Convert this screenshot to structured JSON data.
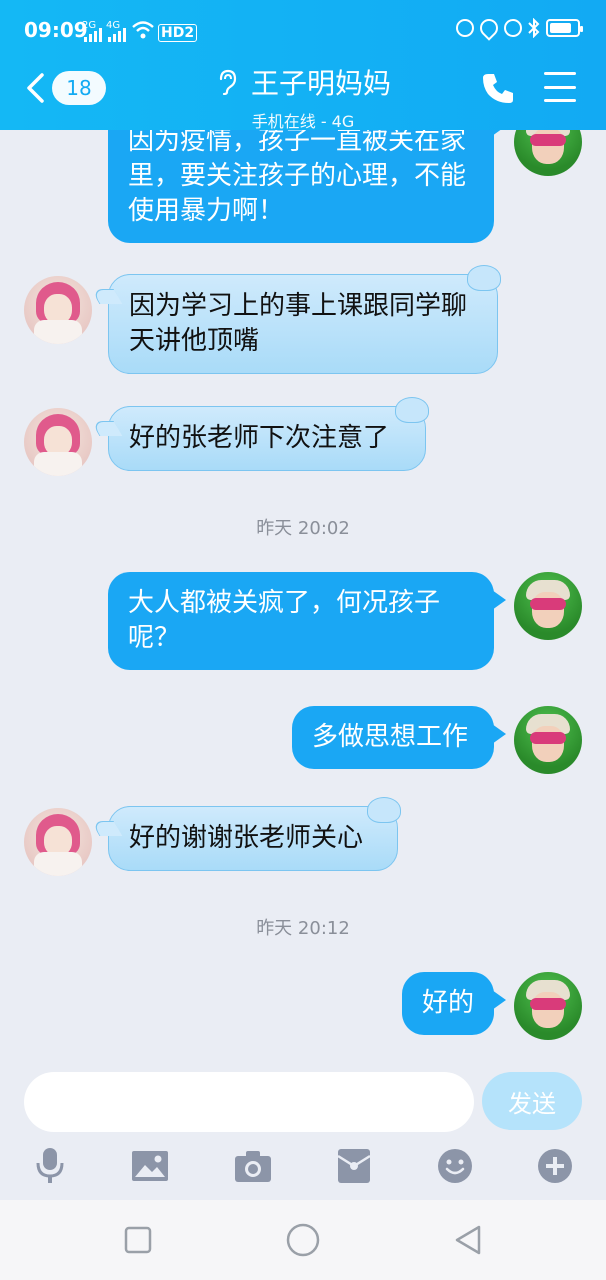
{
  "status_bar": {
    "time": "09:09",
    "sig1": "2G",
    "sig2": "4G",
    "hd": "HD2"
  },
  "header": {
    "back_count": "18",
    "title": "王子明妈妈",
    "subtitle": "手机在线 - 4G"
  },
  "messages": [
    {
      "from": "me",
      "text": "因为疫情，孩子一直被关在家里，要关注孩子的心理，不能使用暴力啊！"
    },
    {
      "from": "them",
      "text": "因为学习上的事上课跟同学聊天讲他顶嘴"
    },
    {
      "from": "them",
      "text": "好的张老师下次注意了"
    },
    {
      "type": "time",
      "text": "昨天 20:02"
    },
    {
      "from": "me",
      "text": "大人都被关疯了，何况孩子呢？"
    },
    {
      "from": "me",
      "text": "多做思想工作"
    },
    {
      "from": "them",
      "text": "好的谢谢张老师关心"
    },
    {
      "type": "time",
      "text": "昨天 20:12"
    },
    {
      "from": "me",
      "text": "好的"
    }
  ],
  "composer": {
    "placeholder": "",
    "send_label": "发送"
  },
  "colors": {
    "header": "#12aaf3",
    "my_bubble": "#1aa7f4",
    "their_bubble": "#bfe4fa",
    "background": "#eaedf4"
  }
}
